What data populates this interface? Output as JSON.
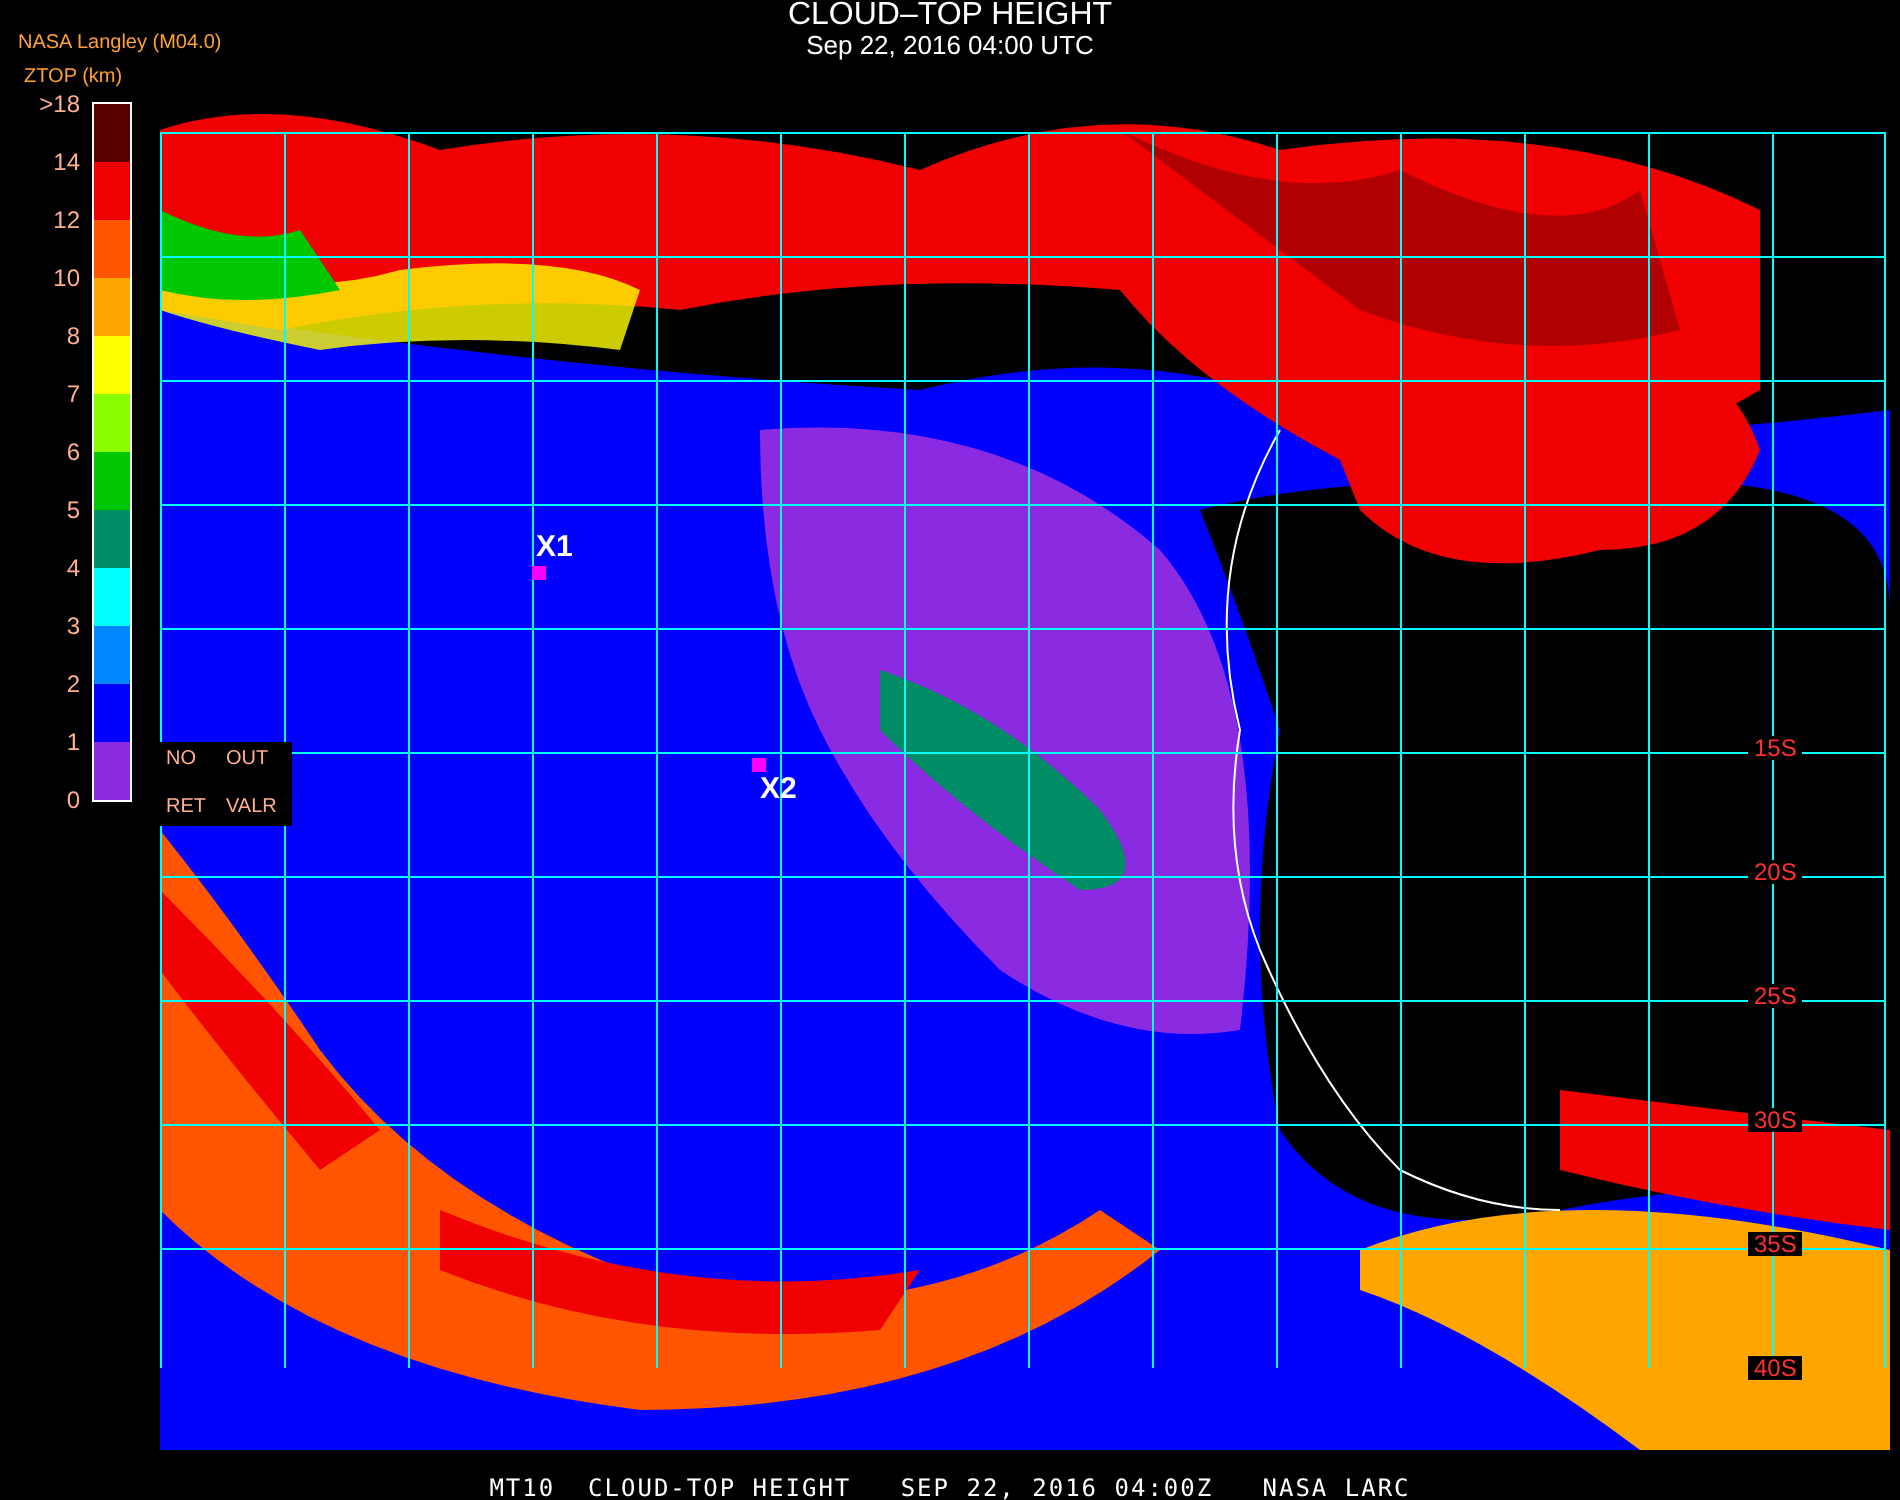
{
  "header": {
    "title": "CLOUD–TOP HEIGHT",
    "subtitle": "Sep 22, 2016 04:00 UTC"
  },
  "legend": {
    "source": "NASA Langley (M04.0)",
    "unit": "ZTOP (km)",
    "scale_labels": [
      ">18",
      "14",
      "12",
      "10",
      "8",
      "7",
      "6",
      "5",
      "4",
      "3",
      "2",
      "1",
      "0"
    ],
    "bins": [
      {
        "color": "#5a0000"
      },
      {
        "color": "#f00000"
      },
      {
        "color": "#ff5500"
      },
      {
        "color": "#ffa500"
      },
      {
        "color": "#ffff00"
      },
      {
        "color": "#88ff00"
      },
      {
        "color": "#00c800"
      },
      {
        "color": "#008c64"
      },
      {
        "color": "#00ffff"
      },
      {
        "color": "#0088ff"
      },
      {
        "color": "#0000ff"
      },
      {
        "color": "#8a2be2"
      }
    ]
  },
  "map": {
    "markers": [
      {
        "label": "X1"
      },
      {
        "label": "X2"
      }
    ],
    "overlay_labels": [
      {
        "label": "NO"
      },
      {
        "label": "OUT"
      },
      {
        "label": "RET"
      },
      {
        "label": "VALR"
      }
    ],
    "latitude_labels": [
      "15S",
      "20S",
      "25S",
      "30S",
      "35S",
      "40S"
    ]
  },
  "footer": "MT10  CLOUD-TOP HEIGHT   SEP 22, 2016 04:00Z   NASA LARC"
}
